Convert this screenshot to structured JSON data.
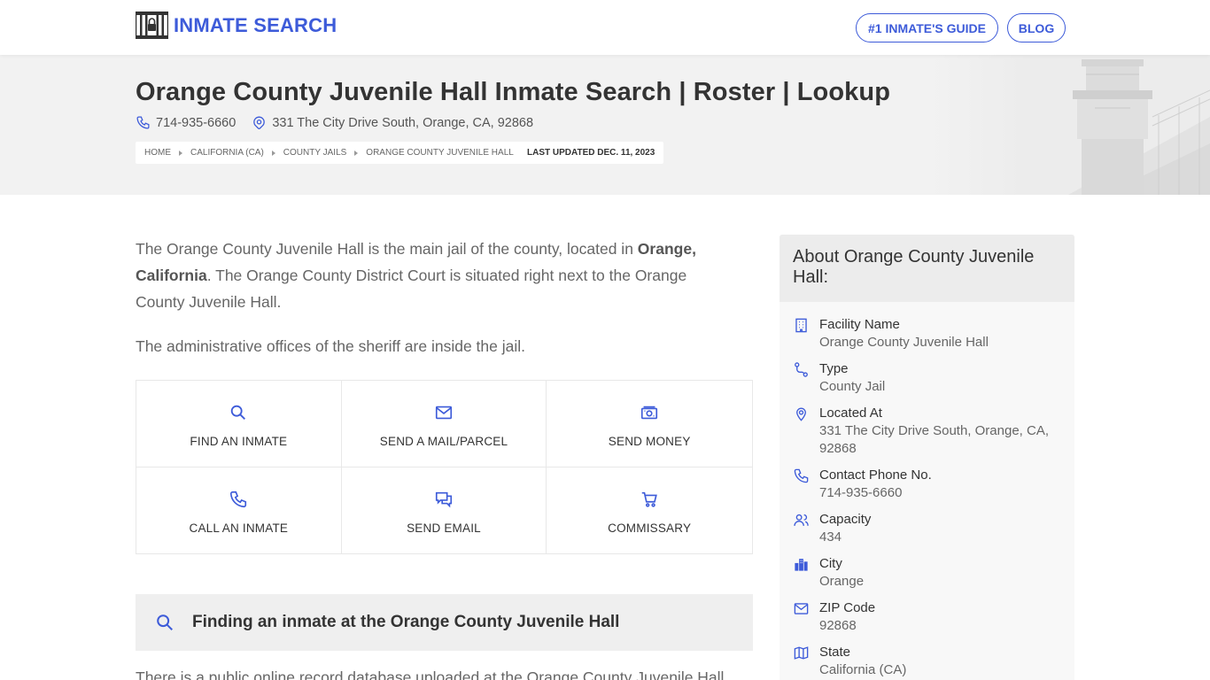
{
  "header": {
    "logo_text": "INMATE SEARCH",
    "nav": {
      "guide": "#1 INMATE'S GUIDE",
      "blog": "BLOG"
    }
  },
  "hero": {
    "title": "Orange County Juvenile Hall Inmate Search | Roster | Lookup",
    "phone": "714-935-6660",
    "address": "331 The City Drive South, Orange, CA, 92868",
    "breadcrumbs": [
      "HOME",
      "CALIFORNIA (CA)",
      "COUNTY JAILS",
      "ORANGE COUNTY JUVENILE HALL"
    ],
    "last_updated": "LAST UPDATED DEC. 11, 2023"
  },
  "main": {
    "intro_a": "The Orange County Juvenile Hall is the main jail of the county, located in ",
    "intro_bold": "Orange, California",
    "intro_b": ". The Orange County District Court is situated right next to the Orange County Juvenile Hall.",
    "intro2": "The administrative offices of the sheriff are inside the jail.",
    "actions": [
      {
        "label": "FIND AN INMATE",
        "icon": "search-icon"
      },
      {
        "label": "SEND A MAIL/PARCEL",
        "icon": "mail-icon"
      },
      {
        "label": "SEND MONEY",
        "icon": "money-icon"
      },
      {
        "label": "CALL AN INMATE",
        "icon": "phone-icon"
      },
      {
        "label": "SEND EMAIL",
        "icon": "chat-icon"
      },
      {
        "label": "COMMISSARY",
        "icon": "cart-icon"
      }
    ],
    "finding_heading": "Finding an inmate at the Orange County Juvenile Hall",
    "para3": "There is a public online record database uploaded at the Orange County Juvenile Hall"
  },
  "sidebar": {
    "title": "About Orange County Juvenile Hall:",
    "items": [
      {
        "key": "Facility Name",
        "value": "Orange County Juvenile Hall",
        "icon": "building-icon"
      },
      {
        "key": "Type",
        "value": "County Jail",
        "icon": "route-icon"
      },
      {
        "key": "Located At",
        "value": "331 The City Drive South, Orange, CA, 92868",
        "icon": "location-pin-icon"
      },
      {
        "key": "Contact Phone No.",
        "value": "714-935-6660",
        "icon": "phone-icon"
      },
      {
        "key": "Capacity",
        "value": "434",
        "icon": "users-icon"
      },
      {
        "key": "City",
        "value": "Orange",
        "icon": "city-icon"
      },
      {
        "key": "ZIP Code",
        "value": "92868",
        "icon": "mail-icon"
      },
      {
        "key": "State",
        "value": "California (CA)",
        "icon": "map-icon"
      }
    ]
  },
  "colors": {
    "accent": "#3d5bd9",
    "hero_bg": "#f2f2f2",
    "text": "#333333"
  }
}
